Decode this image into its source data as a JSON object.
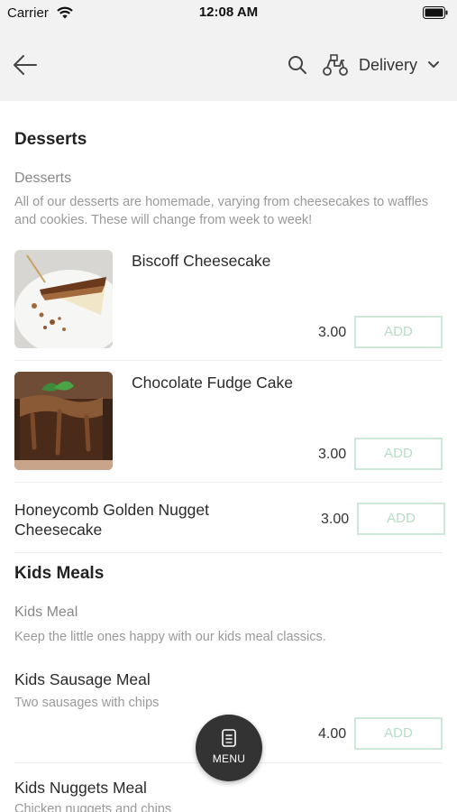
{
  "status_bar": {
    "carrier": "Carrier",
    "time": "12:08 AM"
  },
  "header": {
    "delivery_label": "Delivery"
  },
  "sections": [
    {
      "title": "Desserts",
      "subtitle": "Desserts",
      "description": "All of our desserts are homemade, varying from cheesecakes to waffles and cookies. These will change from week to week!",
      "items": [
        {
          "name": "Biscoff Cheesecake",
          "price": "3.00",
          "add_label": "ADD"
        },
        {
          "name": "Chocolate Fudge Cake",
          "price": "3.00",
          "add_label": "ADD"
        },
        {
          "name": "Honeycomb Golden Nugget Cheesecake",
          "price": "3.00",
          "add_label": "ADD"
        }
      ]
    },
    {
      "title": "Kids Meals",
      "subtitle": "Kids Meal",
      "description": "Keep the little ones happy with our kids meal classics.",
      "items": [
        {
          "name": "Kids Sausage Meal",
          "description": "Two sausages with chips",
          "price": "4.00",
          "add_label": "ADD"
        },
        {
          "name": "Kids Nuggets Meal",
          "description": "Chicken nuggets and chips"
        }
      ]
    }
  ],
  "menu_button": {
    "label": "MENU"
  },
  "colors": {
    "header_bg": "#f2f2f2",
    "add_button_border": "#cde8d8",
    "add_button_text": "#b7dcc6",
    "fab_bg": "#333333"
  }
}
